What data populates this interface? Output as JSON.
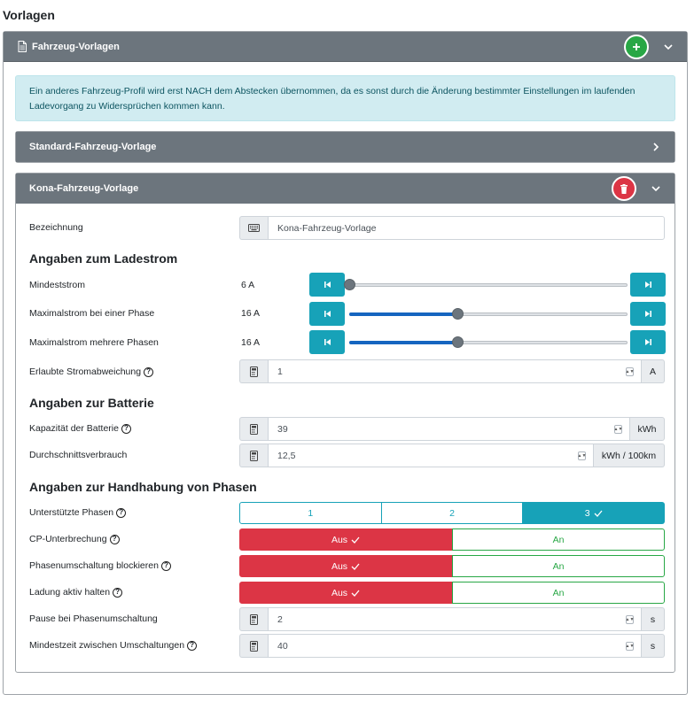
{
  "page_title": "Vorlagen",
  "outer": {
    "title": "Fahrzeug-Vorlagen"
  },
  "alert": "Ein anderes Fahrzeug-Profil wird erst NACH dem Abstecken übernommen, da es sonst durch die Änderung bestimmter Einstellungen im laufenden Ladevorgang zu Widersprüchen kommen kann.",
  "standard": {
    "title": "Standard-Fahrzeug-Vorlage"
  },
  "kona": {
    "title": "Kona-Fahrzeug-Vorlage",
    "bezeichnung_label": "Bezeichnung",
    "bezeichnung_value": "Kona-Fahrzeug-Vorlage",
    "section_ladestrom": "Angaben zum Ladestrom",
    "mindeststrom_label": "Mindeststrom",
    "mindeststrom_value": "6 A",
    "max_einphase_label": "Maximalstrom bei einer Phase",
    "max_einphase_value": "16 A",
    "max_mehrphasen_label": "Maximalstrom mehrere Phasen",
    "max_mehrphasen_value": "16 A",
    "abweichung_label": "Erlaubte Stromabweichung",
    "abweichung_value": "1",
    "abweichung_unit": "A",
    "section_batterie": "Angaben zur Batterie",
    "kapazitaet_label": "Kapazität der Batterie",
    "kapazitaet_value": "39",
    "kapazitaet_unit": "kWh",
    "verbrauch_label": "Durchschnittsverbrauch",
    "verbrauch_value": "12,5",
    "verbrauch_unit": "kWh / 100km",
    "section_phasen": "Angaben zur Handhabung von Phasen",
    "phasen_label": "Unterstützte Phasen",
    "phasen_options": [
      "1",
      "2",
      "3"
    ],
    "cp_label": "CP-Unterbrechung",
    "blockieren_label": "Phasenumschaltung blockieren",
    "aktiv_label": "Ladung aktiv halten",
    "aus": "Aus",
    "an": "An",
    "pause_label": "Pause bei Phasenumschaltung",
    "pause_value": "2",
    "pause_unit": "s",
    "mindestzeit_label": "Mindestzeit zwischen Umschaltungen",
    "mindestzeit_value": "40",
    "mindestzeit_unit": "s"
  },
  "sliders": {
    "mindeststrom_fraction": 0.0,
    "max_einphase_fraction": 0.39,
    "max_mehrphasen_fraction": 0.39
  },
  "colors": {
    "info": "#17a2b8",
    "danger": "#dc3545",
    "success": "#28a745",
    "header": "#6c757d",
    "slider_fill": "#1565c0"
  }
}
